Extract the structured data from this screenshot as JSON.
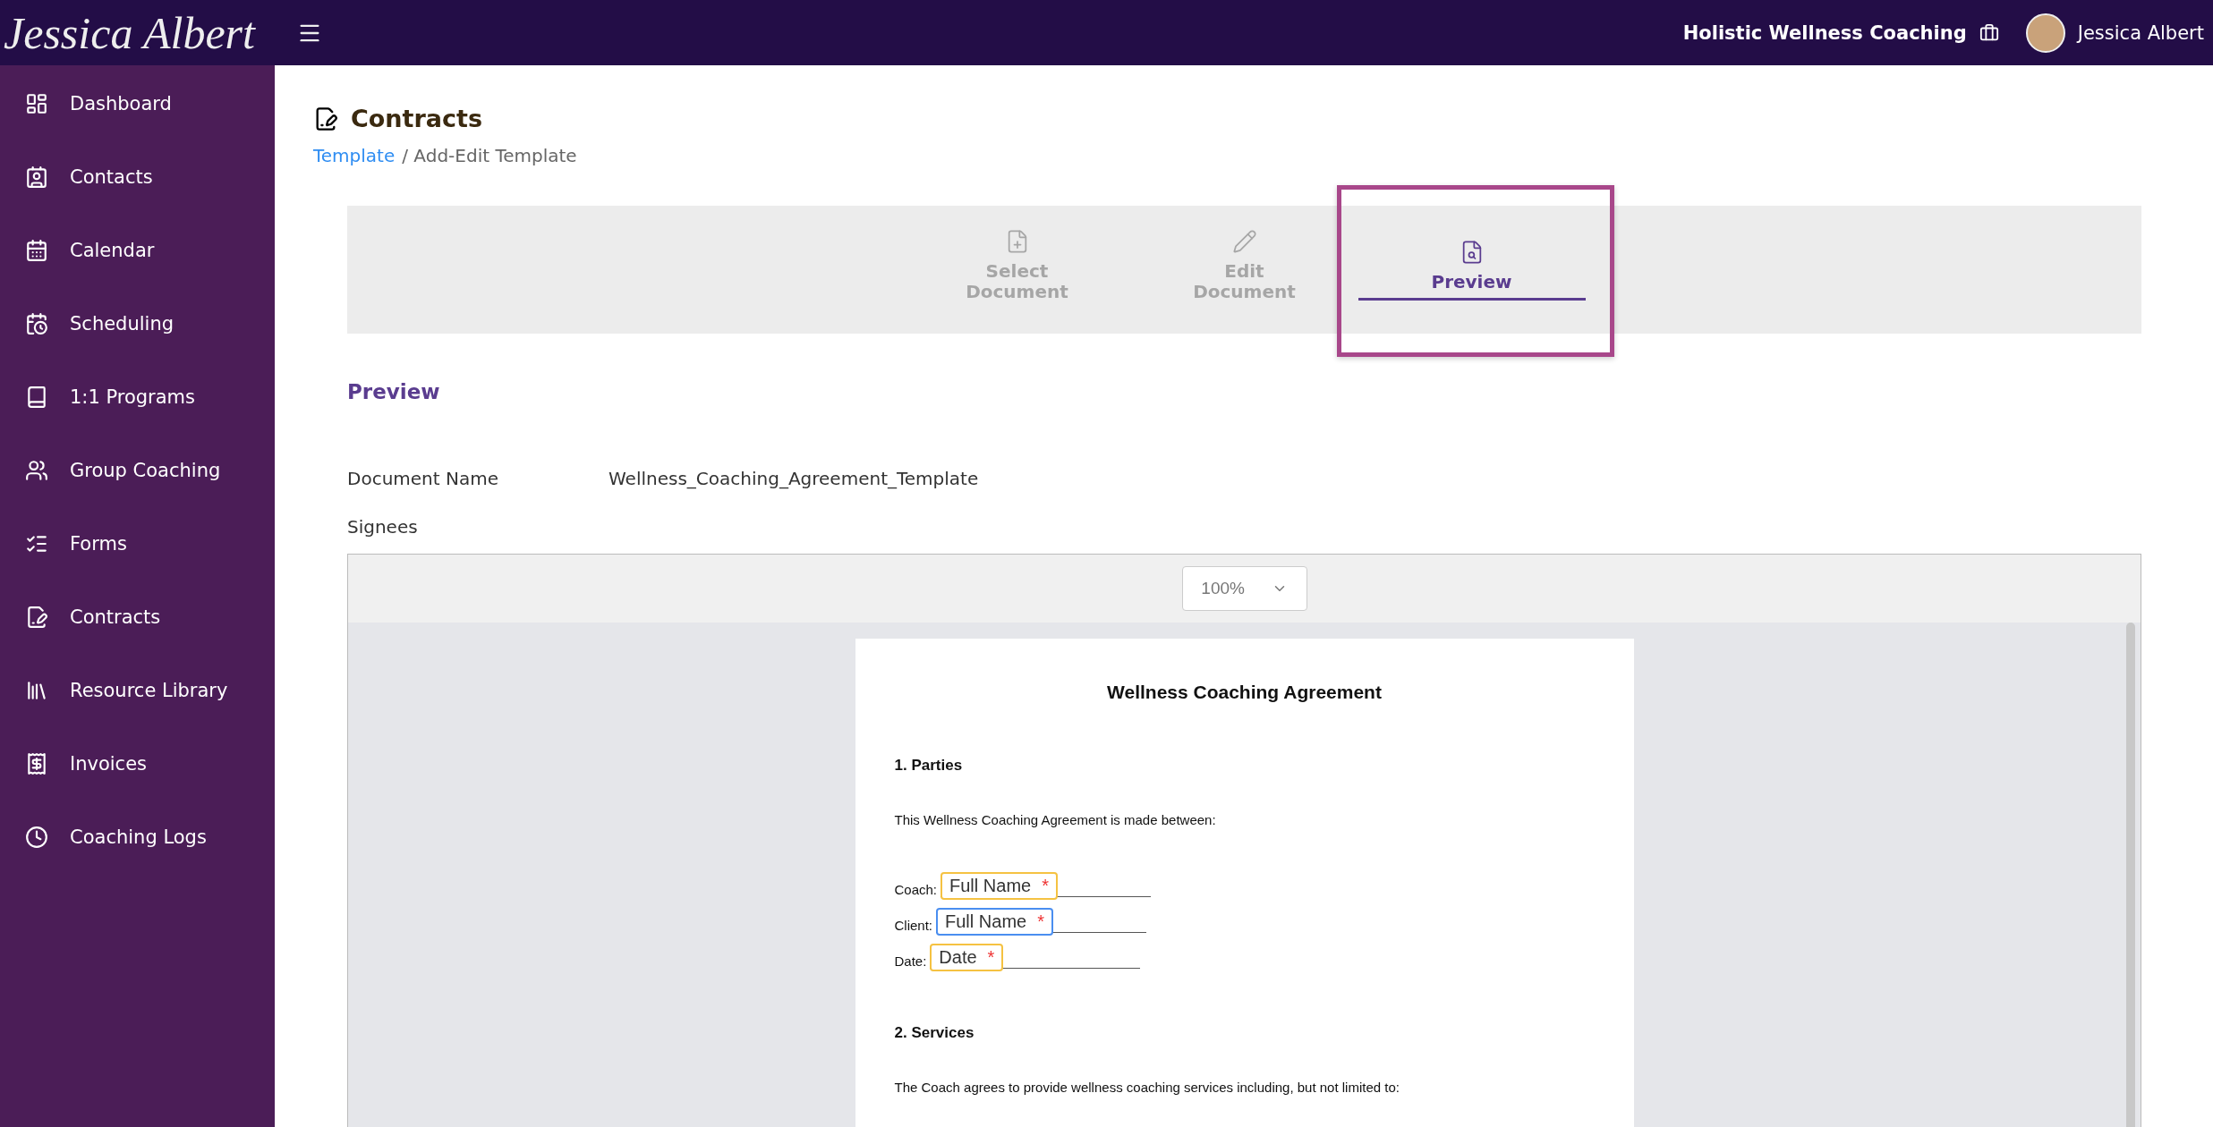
{
  "header": {
    "logo": "Jessica Albert",
    "business": "Holistic Wellness Coaching",
    "user": "Jessica Albert"
  },
  "sidebar": {
    "items": [
      {
        "label": "Dashboard",
        "selected": false
      },
      {
        "label": "Contacts",
        "selected": false
      },
      {
        "label": "Calendar",
        "selected": false
      },
      {
        "label": "Scheduling",
        "selected": false
      },
      {
        "label": "1:1 Programs",
        "selected": false
      },
      {
        "label": "Group Coaching",
        "selected": false
      },
      {
        "label": "Forms",
        "selected": false
      },
      {
        "label": "Contracts",
        "selected": false
      },
      {
        "label": "Resource Library",
        "selected": false
      },
      {
        "label": "Invoices",
        "selected": false
      },
      {
        "label": "Coaching Logs",
        "selected": false
      }
    ]
  },
  "page": {
    "title": "Contracts",
    "breadcrumb": [
      {
        "label": "Template",
        "kind": "link"
      },
      {
        "label": "/ Add-Edit Template",
        "kind": "text"
      }
    ]
  },
  "steps": [
    {
      "label": "Select\nDocument",
      "selected": false,
      "highlighted": false
    },
    {
      "label": "Edit\nDocument",
      "selected": false,
      "highlighted": false
    },
    {
      "label": "Preview",
      "selected": true,
      "highlighted": true
    }
  ],
  "section_title": "Preview",
  "fields": [
    {
      "label": "Document Name",
      "value": "Wellness_Coaching_Agreement_Template"
    },
    {
      "label": "Signees"
    }
  ],
  "viewer": {
    "zoom": "100%",
    "document": {
      "title": "Wellness Coaching Agreement",
      "blocks": [
        {
          "kind": "heading",
          "text": "1. Parties"
        },
        {
          "kind": "paragraph",
          "text": "This Wellness Coaching Agreement is made between:"
        },
        {
          "kind": "signature",
          "label": "Coach:",
          "tag": "Full Name",
          "marker": "*",
          "color": "#f5c242"
        },
        {
          "kind": "signature",
          "label": "Client:",
          "tag": "Full Name",
          "marker": "*",
          "color": "#4a8ef0"
        },
        {
          "kind": "signature",
          "label": "Date:",
          "tag": "Date",
          "marker": "*",
          "color": "#f5c242"
        },
        {
          "kind": "heading",
          "text": "2. Services"
        },
        {
          "kind": "paragraph",
          "text": "The Coach agrees to provide wellness coaching services including, but not limited to:"
        }
      ]
    }
  }
}
